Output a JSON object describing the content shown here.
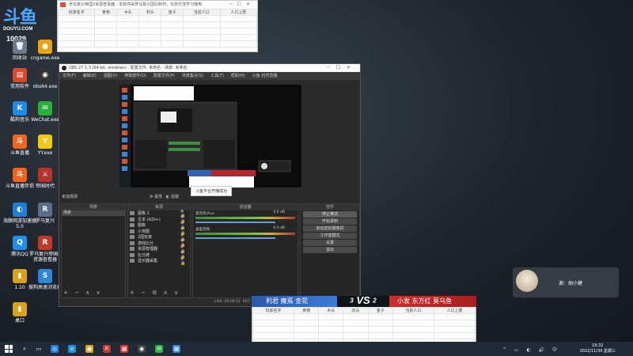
{
  "desktop": {
    "logo": {
      "mark": "斗鱼",
      "site": "DOUYU.COM"
    },
    "room_number": "10029",
    "icons": [
      {
        "label": "回收站",
        "glyph": "🗑",
        "color": "#6b7a8a"
      },
      {
        "label": "cngame.exe",
        "glyph": "●",
        "color": "#e8a317"
      },
      {
        "label": "常用软件",
        "glyph": "▤",
        "color": "#d94a2b"
      },
      {
        "label": "obs64.exe",
        "glyph": "◉",
        "color": "#333333"
      },
      {
        "label": "酷狗音乐",
        "glyph": "K",
        "color": "#1f8ae8"
      },
      {
        "label": "WeChat.exe",
        "glyph": "✉",
        "color": "#28b13b"
      },
      {
        "label": "斗鱼直播",
        "glyph": "斗",
        "color": "#f0641e"
      },
      {
        "label": "YY.exe",
        "glyph": "Y",
        "color": "#f3c814"
      },
      {
        "label": "斗鱼直播伴侣",
        "glyph": "斗",
        "color": "#f0641e"
      },
      {
        "label": "帝国时代",
        "glyph": "⚔",
        "color": "#b8322c"
      },
      {
        "label": "海豚网游加速器5.0",
        "glyph": "◐",
        "color": "#1e7fd9"
      },
      {
        "label": "罗马复兴",
        "glyph": "R",
        "color": "#5a6e8c"
      },
      {
        "label": "腾讯QQ",
        "glyph": "Q",
        "color": "#1e90e8"
      },
      {
        "label": "罗马复兴帝国2资源查看器",
        "glyph": "R",
        "color": "#c0392b"
      },
      {
        "label": "1.10",
        "glyph": "▮",
        "color": "#d9a21c"
      },
      {
        "label": "搜狗高速浏览器",
        "glyph": "S",
        "color": "#2f86d8"
      },
      {
        "label": "桌口",
        "glyph": "▮",
        "color": "#d9a21c"
      }
    ]
  },
  "sheet_top": {
    "title": "罗马复兴帝国2资源查看器 - 本软件由罗马复兴团队制作，仅供交流学习使用",
    "columns": [
      "玩家名字",
      "食物",
      "木头",
      "石头",
      "金子",
      "当前人口",
      "人口上限"
    ]
  },
  "sheet_bottom": {
    "columns": [
      "玩家名字",
      "食物",
      "木头",
      "石头",
      "金子",
      "当前人口",
      "人口上限"
    ]
  },
  "obs": {
    "title": "OBS 27.1.3 (64-bit, windows) - 配置文件: 未命名 - 场景: 未命名",
    "menu": [
      "文件(F)",
      "编辑(E)",
      "视图(V)",
      "停靠部件(D)",
      "配置文件(P)",
      "场景集合(S)",
      "工具(T)",
      "帮助(H)",
      "斗鱼-自然直播"
    ],
    "status_left": "未选择源",
    "studio_label": "属性",
    "filter_label": "滤镜",
    "toast": "斗鱼平台开播成功",
    "scenes": {
      "header": "场景",
      "items": [
        "场景"
      ]
    },
    "sources": {
      "header": "来源",
      "items": [
        "图像 2",
        "文本 (GDI+)",
        "图像",
        "小地图",
        "2国玩家",
        "游戏比分",
        "资源管理器",
        "比分牌",
        "显示器采集"
      ]
    },
    "mixer": {
      "header": "混音器",
      "channels": [
        {
          "name": "麦克风/Aux",
          "db": "0.0 dB"
        },
        {
          "name": "桌面音频",
          "db": "0.0 dB"
        }
      ]
    },
    "controls": {
      "header": "控件",
      "buttons": [
        "停止推流",
        "开始录制",
        "启动虚拟摄像机",
        "工作室模式",
        "设置",
        "退出"
      ]
    },
    "footer": {
      "live": "LIVE: 00:09:22",
      "rec": "REC: 00:00:00",
      "cpu": "CPU: 3.0%, 30.00 fps"
    }
  },
  "vs_overlay": {
    "left_team": "利君 魔焉 金花",
    "left_score": "3",
    "vs": "VS",
    "right_score": "2",
    "right_team": "小发 东方红 莫乌鱼"
  },
  "chat": {
    "text": "谢：胡小健"
  },
  "taskbar": {
    "time": "19:32",
    "date": "2022/11/30 星期三",
    "apps": [
      {
        "glyph": "◎",
        "color": "#1e7fd9"
      },
      {
        "glyph": "e",
        "color": "#1e90e8"
      },
      {
        "glyph": "●",
        "color": "#e8a317"
      },
      {
        "glyph": "R",
        "color": "#c0392b"
      },
      {
        "glyph": "▦",
        "color": "#d9352b"
      },
      {
        "glyph": "◉",
        "color": "#444444"
      },
      {
        "glyph": "✉",
        "color": "#28b13b"
      },
      {
        "glyph": "▦",
        "color": "#2f86d8"
      }
    ]
  }
}
